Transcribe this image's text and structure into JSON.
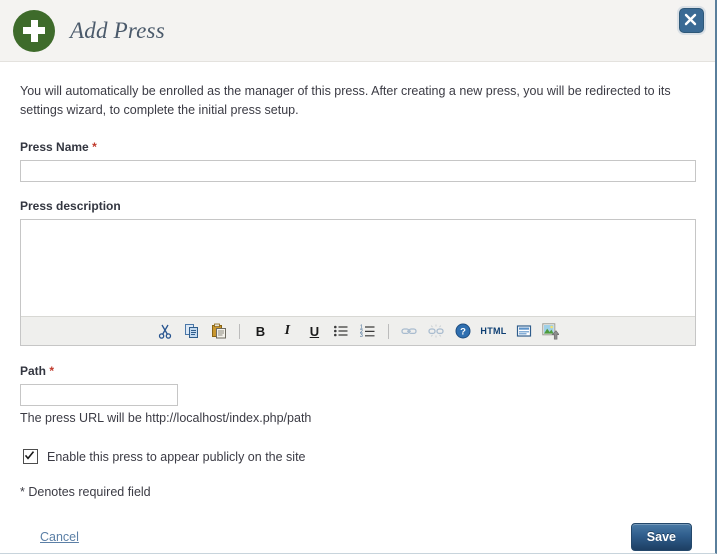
{
  "header": {
    "title": "Add Press",
    "plus_icon": "plus-circle-icon",
    "close_icon": "close-icon"
  },
  "intro": {
    "text": "You will automatically be enrolled as the manager of this press. After creating a new press, you will be redirected to its settings wizard, to complete the initial press setup."
  },
  "form": {
    "press_name": {
      "label": "Press Name",
      "required_marker": "*",
      "value": "",
      "placeholder": ""
    },
    "press_description": {
      "label": "Press description",
      "value": ""
    },
    "path": {
      "label": "Path",
      "required_marker": "*",
      "value": "",
      "placeholder": "",
      "helper": "The press URL will be http://localhost/index.php/path"
    },
    "enable_public": {
      "label": "Enable this press to appear publicly on the site",
      "checked": true
    },
    "denotes_note": "* Denotes required field"
  },
  "editor_toolbar": {
    "buttons": [
      {
        "name": "cut-icon",
        "label": "Cut"
      },
      {
        "name": "copy-icon",
        "label": "Copy"
      },
      {
        "name": "paste-icon",
        "label": "Paste"
      },
      {
        "name": "bold-icon",
        "label": "B"
      },
      {
        "name": "italic-icon",
        "label": "I"
      },
      {
        "name": "underline-icon",
        "label": "U"
      },
      {
        "name": "bullet-list-icon",
        "label": "Bulleted list"
      },
      {
        "name": "numbered-list-icon",
        "label": "Numbered list"
      },
      {
        "name": "link-icon",
        "label": "Link"
      },
      {
        "name": "unlink-icon",
        "label": "Unlink"
      },
      {
        "name": "help-icon",
        "label": "Help"
      },
      {
        "name": "html-source-icon",
        "label": "HTML"
      },
      {
        "name": "panel-icon",
        "label": "Panel"
      },
      {
        "name": "image-upload-icon",
        "label": "Image"
      }
    ],
    "html_label": "HTML"
  },
  "footer": {
    "cancel_label": "Cancel",
    "save_label": "Save"
  },
  "colors": {
    "accent_green": "#3e6b2b",
    "accent_blue": "#3a6a94",
    "required_red": "#c0392b",
    "header_bg": "#f4f3f1",
    "toolbar_bg": "#efefed",
    "link_blue": "#5b7fa6"
  }
}
